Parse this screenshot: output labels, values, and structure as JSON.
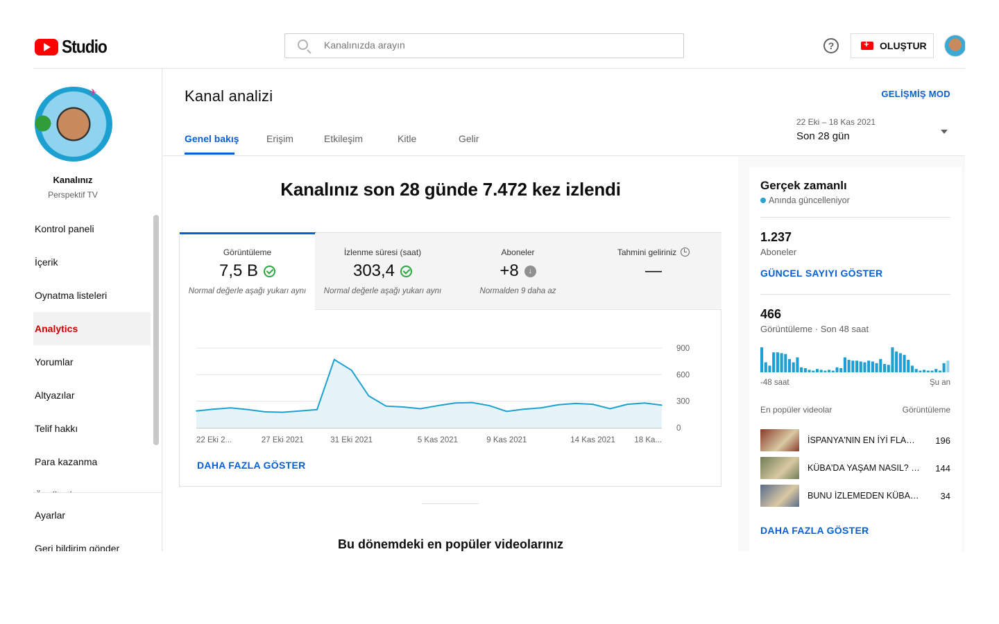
{
  "header": {
    "logo_text": "Studio",
    "search_placeholder": "Kanalınızda arayın",
    "help_icon": "?",
    "create_label": "OLUŞTUR"
  },
  "sidebar": {
    "channel_label": "Kanalınız",
    "channel_name": "Perspektif TV",
    "items": [
      {
        "label": "Kontrol paneli"
      },
      {
        "label": "İçerik"
      },
      {
        "label": "Oynatma listeleri"
      },
      {
        "label": "Analytics"
      },
      {
        "label": "Yorumlar"
      },
      {
        "label": "Altyazılar"
      },
      {
        "label": "Telif hakkı"
      },
      {
        "label": "Para kazanma"
      },
      {
        "label": "Özelleştirme"
      }
    ],
    "bottom_items": [
      {
        "label": "Ayarlar"
      },
      {
        "label": "Geri bildirim gönder"
      }
    ]
  },
  "page": {
    "title": "Kanal analizi",
    "advanced_mode": "GELİŞMİŞ MOD",
    "tabs": [
      {
        "label": "Genel bakış"
      },
      {
        "label": "Erişim"
      },
      {
        "label": "Etkileşim"
      },
      {
        "label": "Kitle"
      },
      {
        "label": "Gelir"
      }
    ],
    "date_range": "22 Eki – 18 Kas 2021",
    "date_label": "Son 28 gün",
    "headline": "Kanalınız son 28 günde 7.472 kez izlendi",
    "show_more": "DAHA FAZLA GÖSTER",
    "popular_title": "Bu dönemdeki en popüler videolarınız"
  },
  "metrics": [
    {
      "label": "Görüntüleme",
      "value": "7,5 B",
      "note": "Normal değerle aşağı yukarı aynı",
      "status_icon": "check-circle-icon"
    },
    {
      "label": "İzlenme süresi (saat)",
      "value": "303,4",
      "note": "Normal değerle aşağı yukarı aynı",
      "status_icon": "check-circle-icon"
    },
    {
      "label": "Aboneler",
      "value": "+8",
      "note": "Normalden 9 daha az",
      "status_icon": "down-arrow-circle-icon"
    },
    {
      "label": "Tahmini geliriniz",
      "value": "—",
      "note": "",
      "status_icon": "clock-icon"
    }
  ],
  "chart_data": {
    "type": "area",
    "title": "",
    "xlabel": "",
    "ylabel": "",
    "x_tick_labels": [
      "22 Eki 2...",
      "27 Eki 2021",
      "31 Eki 2021",
      "5 Kas 2021",
      "9 Kas 2021",
      "14 Kas 2021",
      "18 Ka..."
    ],
    "y_ticks": [
      0,
      300,
      600,
      900
    ],
    "ylim": [
      0,
      900
    ],
    "x": [
      "22 Eki",
      "23 Eki",
      "24 Eki",
      "25 Eki",
      "26 Eki",
      "27 Eki",
      "28 Eki",
      "29 Eki",
      "30 Eki",
      "31 Eki",
      "1 Kas",
      "2 Kas",
      "3 Kas",
      "4 Kas",
      "5 Kas",
      "6 Kas",
      "7 Kas",
      "8 Kas",
      "9 Kas",
      "10 Kas",
      "11 Kas",
      "12 Kas",
      "13 Kas",
      "14 Kas",
      "15 Kas",
      "16 Kas",
      "17 Kas",
      "18 Kas"
    ],
    "values": [
      190,
      210,
      225,
      205,
      180,
      175,
      190,
      205,
      770,
      650,
      360,
      245,
      235,
      215,
      250,
      280,
      285,
      250,
      185,
      210,
      225,
      260,
      275,
      265,
      215,
      265,
      280,
      255
    ],
    "series_color": "#1ba0d1",
    "fill_color": "#e6f4fa",
    "grid": true
  },
  "realtime": {
    "title": "Gerçek zamanlı",
    "live_label": "Anında güncelleniyor",
    "subscribers_value": "1.237",
    "subscribers_label": "Aboneler",
    "show_count_link": "GÜNCEL SAYIYI GÖSTER",
    "views_value": "466",
    "views_label": "Görüntüleme · Son 48 saat",
    "axis_start": "-48 saat",
    "axis_end": "Şu an",
    "bar_color": "#1ba0d1",
    "hourly_views": [
      30,
      12,
      8,
      24,
      24,
      23,
      22,
      16,
      12,
      18,
      6,
      5,
      3,
      2,
      4,
      3,
      2,
      3,
      2,
      6,
      5,
      18,
      15,
      14,
      14,
      13,
      12,
      14,
      13,
      11,
      16,
      10,
      9,
      30,
      25,
      23,
      21,
      15,
      8,
      4,
      2,
      3,
      2,
      2,
      4,
      2,
      11,
      14
    ],
    "top_videos_header": "En popüler videolar",
    "views_header": "Görüntüleme",
    "top_videos": [
      {
        "title": "İSPANYA'NIN EN İYİ FLAMENKO ŞOVU",
        "views": "196",
        "thumb_color": "#8a3b2b"
      },
      {
        "title": "KÜBA'DA YAŞAM NASIL? İLK İZLENİMLER",
        "views": "144",
        "thumb_color": "#6f7d56"
      },
      {
        "title": "BUNU İZLEMEDEN KÜBA'YA GİTMEYİN",
        "views": "34",
        "thumb_color": "#5a6b8c"
      }
    ],
    "show_more": "DAHA FAZLA GÖSTER"
  }
}
